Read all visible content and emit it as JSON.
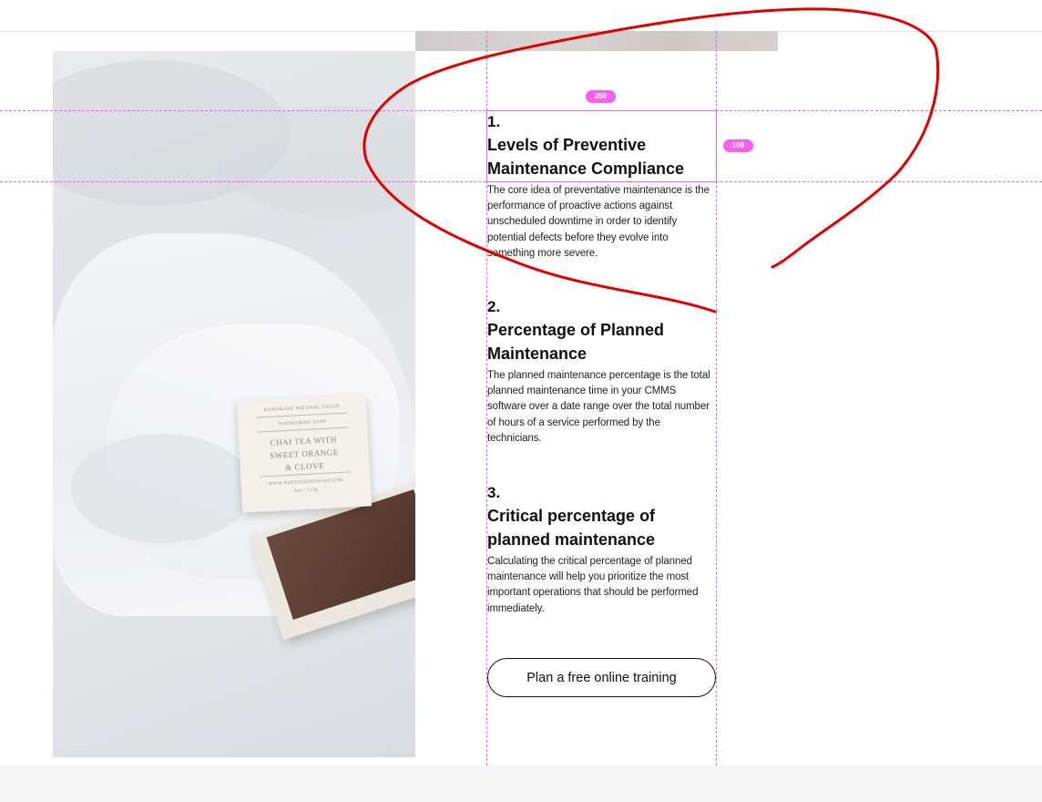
{
  "photo": {
    "alt": "Soap bar box on crumpled white paper",
    "box_lines": [
      "HANDMADE NATURAL VEGAN",
      "NOURISHING SOAP",
      "CHAI TEA WITH",
      "SWEET ORANGE",
      "& CLOVE",
      "WWW.NOURISHINGSOAP.COM",
      "4oz / 113g"
    ]
  },
  "guides": {
    "width_label": "350",
    "height_label": "108"
  },
  "sections": [
    {
      "number": "1.",
      "title_line1": "Levels of Preventive",
      "title_line2": "Maintenance Compliance",
      "body": "The core idea of preventative maintenance is the performance of proactive actions against unscheduled downtime in order to identify potential defects before they evolve into something more severe."
    },
    {
      "number": "2.",
      "title_line1": "Percentage of Planned",
      "title_line2": "Maintenance",
      "body": "The planned maintenance percentage is the total planned maintenance time in your CMMS software over a date range over the total number of hours of a service performed by the technicians."
    },
    {
      "number": "3.",
      "title_line1": "Critical percentage of",
      "title_line2": "planned maintenance",
      "body": "Calculating the critical percentage of planned maintenance will help you prioritize the most important operations that should be performed immediately."
    }
  ],
  "cta": {
    "label": "Plan a free online training"
  },
  "colors": {
    "guide": "#e264e5",
    "annotation": "#e00000",
    "text": "#111111"
  }
}
